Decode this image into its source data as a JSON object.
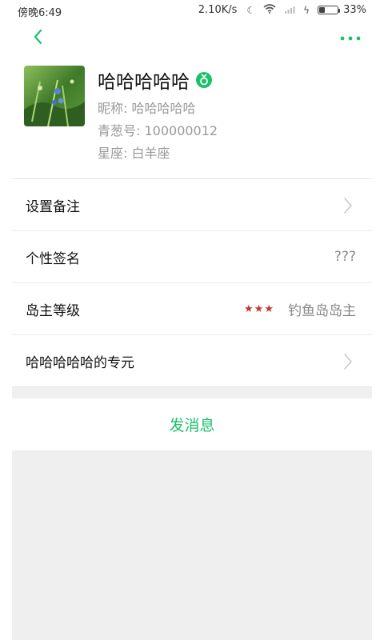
{
  "status_bar": {
    "time": "傍晚6:49",
    "speed": "2.10K/s",
    "battery": "33%",
    "battery_level": 0.33
  },
  "toolbar": {
    "back_icon": "chevron-left-icon",
    "more_icon": "more-dots-icon",
    "accent_color": "#1bc16a"
  },
  "profile": {
    "name": "哈哈哈哈哈",
    "gender_icon": "female-symbol-icon",
    "nickname": "昵称: 哈哈哈哈哈",
    "qingcong_id": "青葱号: 100000012",
    "constellation": "星座: 白羊座"
  },
  "rows": [
    {
      "label": "设置备注"
    },
    {
      "label": "个性签名",
      "value": "???"
    },
    {
      "label": "岛主等级",
      "stars": "★★★",
      "value": "钓鱼岛岛主"
    },
    {
      "label": "哈哈哈哈哈的专元"
    }
  ],
  "send_message": "发消息"
}
